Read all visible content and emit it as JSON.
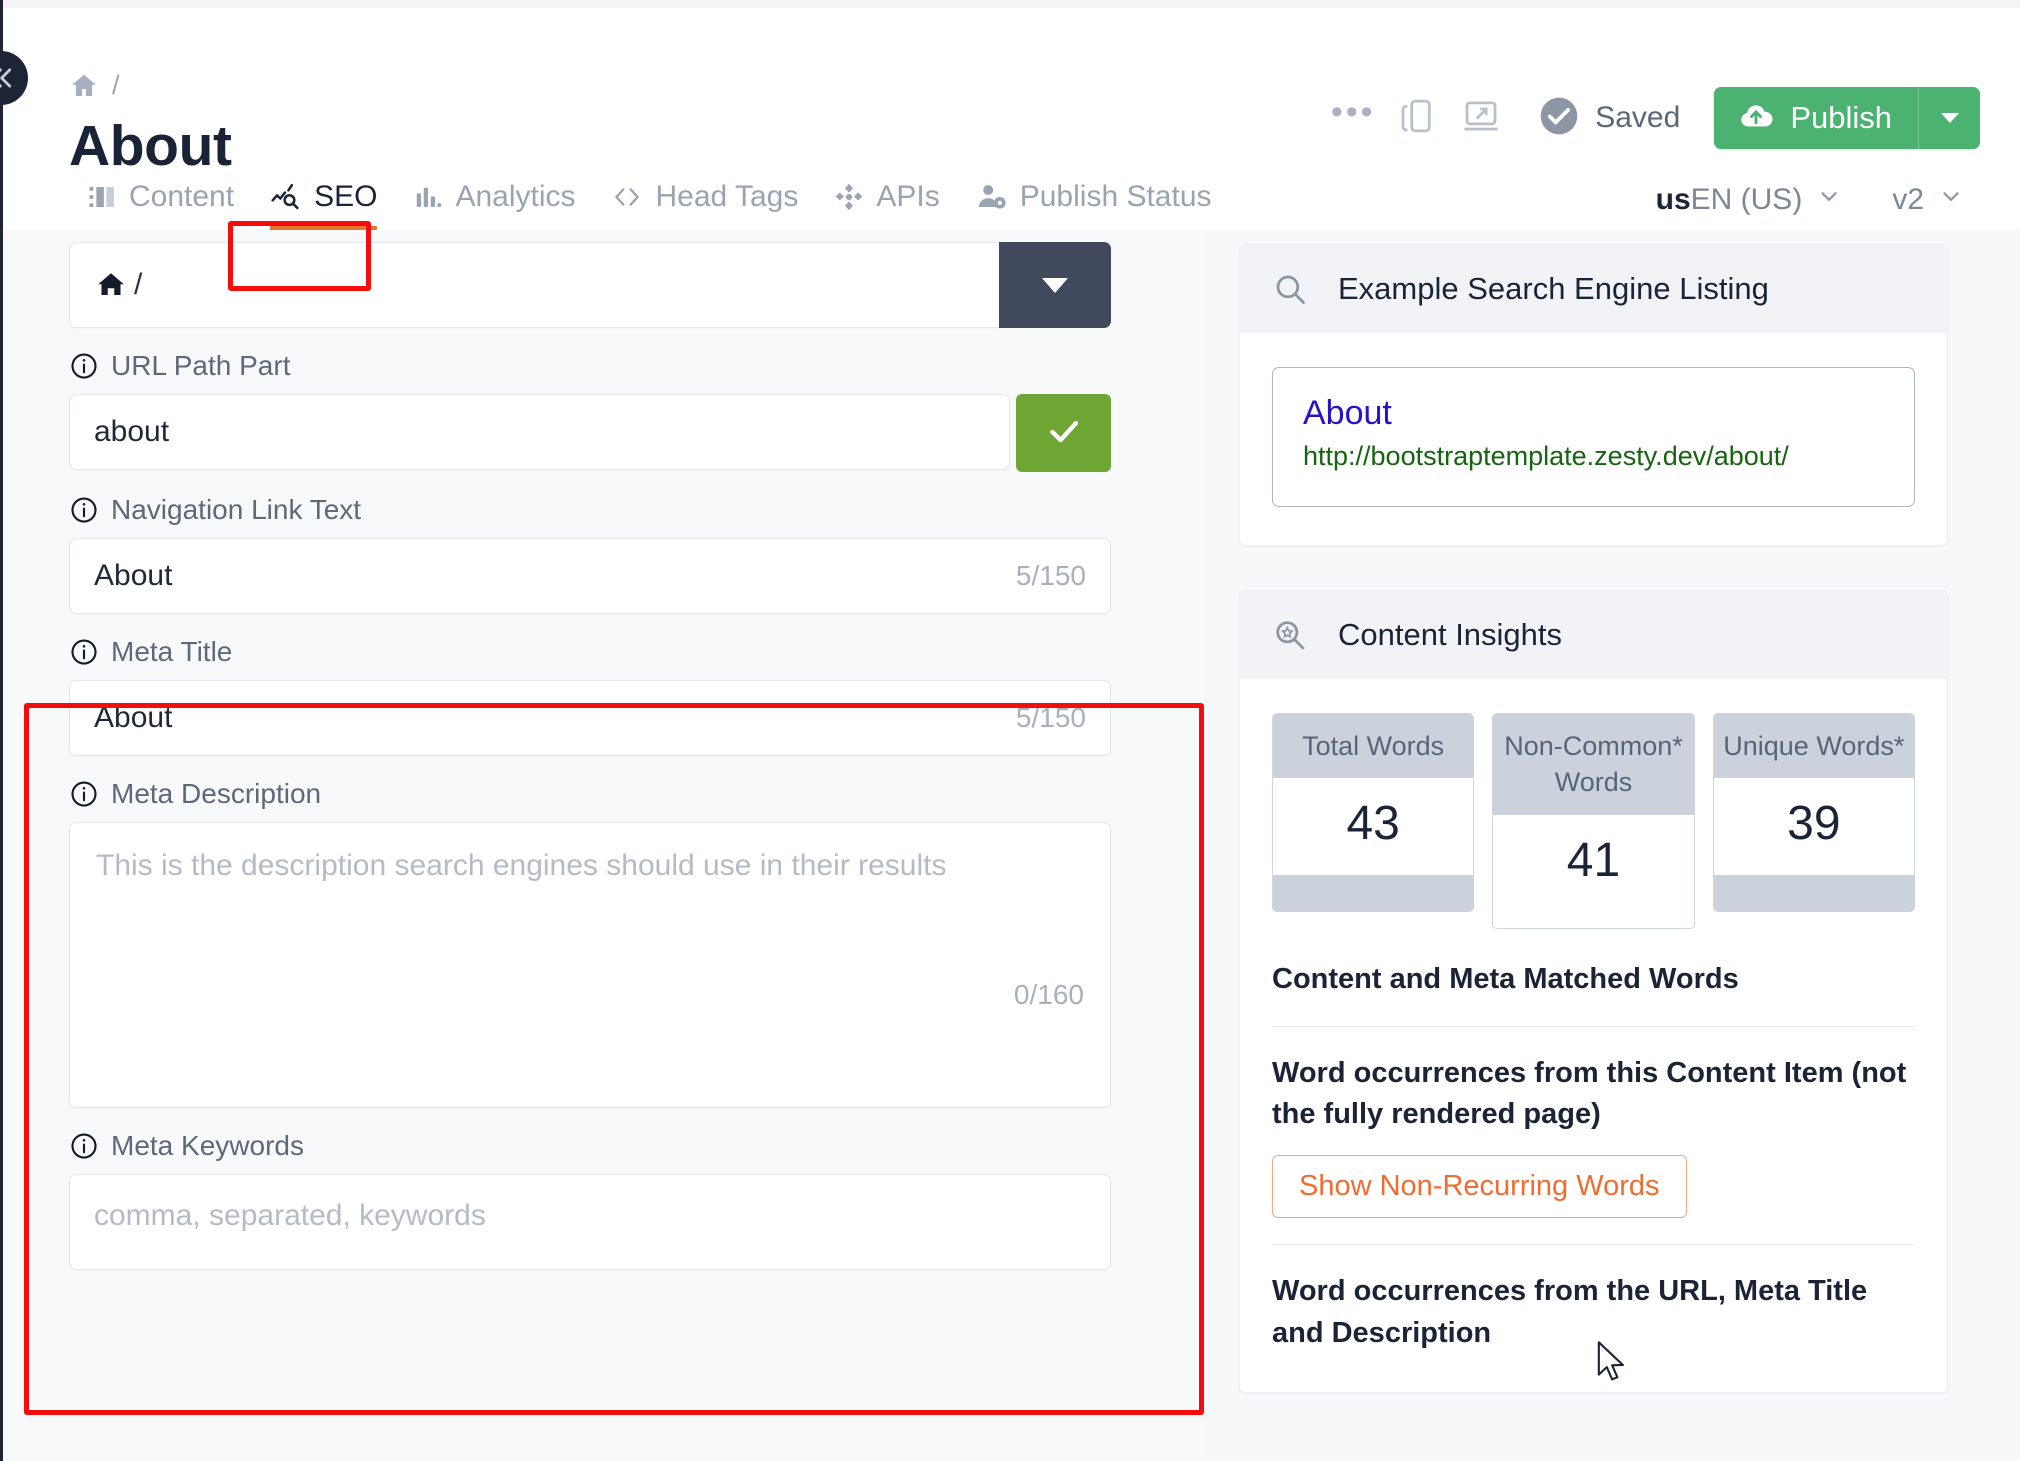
{
  "window": {
    "collapse_icon": "chevrons-left-icon"
  },
  "header": {
    "breadcrumb_home_icon": "home-icon",
    "breadcrumb_separator": "/",
    "page_title": "About",
    "more_icon": "ellipsis-icon",
    "more_label": "•••",
    "duplicate_icon": "copy-device-icon",
    "preview_icon": "open-in-browser-icon",
    "status_icon": "check-circle-icon",
    "status_label": "Saved",
    "publish_icon": "cloud-upload-icon",
    "publish_label": "Publish",
    "publish_caret_icon": "caret-down-icon"
  },
  "tabs": [
    {
      "label": "Content",
      "icon": "content-blocks-icon",
      "active": false
    },
    {
      "label": "SEO",
      "icon": "seo-search-icon",
      "active": true
    },
    {
      "label": "Analytics",
      "icon": "bar-chart-icon",
      "active": false
    },
    {
      "label": "Head Tags",
      "icon": "code-brackets-icon",
      "active": false
    },
    {
      "label": "APIs",
      "icon": "api-nodes-icon",
      "active": false
    },
    {
      "label": "Publish Status",
      "icon": "user-gear-icon",
      "active": false
    }
  ],
  "selectors": {
    "language_prefix": "us",
    "language_label": "EN (US)",
    "language_caret_icon": "chevron-down-icon",
    "version_label": "v2",
    "version_caret_icon": "chevron-down-icon"
  },
  "form": {
    "parent_path": {
      "home_icon": "home-icon",
      "value": "/",
      "caret_icon": "caret-down-icon"
    },
    "url_path_part": {
      "info_icon": "info-icon",
      "label": "URL Path Part",
      "value": "about",
      "confirm_icon": "check-icon"
    },
    "navigation_link_text": {
      "info_icon": "info-icon",
      "label": "Navigation Link Text",
      "value": "About",
      "counter": "5/150"
    },
    "meta_title": {
      "info_icon": "info-icon",
      "label": "Meta Title",
      "value": "About",
      "counter": "5/150"
    },
    "meta_description": {
      "info_icon": "info-icon",
      "label": "Meta Description",
      "placeholder": "This is the description search engines should use in their results",
      "value": "",
      "counter": "0/160"
    },
    "meta_keywords": {
      "info_icon": "info-icon",
      "label": "Meta Keywords",
      "placeholder": "comma, separated, keywords",
      "value": ""
    }
  },
  "search_listing": {
    "icon": "search-icon",
    "title": "Example Search Engine Listing",
    "result_title": "About",
    "result_url": "http://bootstraptemplate.zesty.dev/about/"
  },
  "content_insights": {
    "icon": "search-star-icon",
    "title": "Content Insights",
    "metrics": [
      {
        "label": "Total Words",
        "value": "43"
      },
      {
        "label": "Non-Common* Words",
        "value": "41"
      },
      {
        "label": "Unique Words*",
        "value": "39"
      }
    ],
    "matched_words_heading": "Content and Meta Matched Words",
    "content_item_heading": "Word occurrences from this Content Item (not the fully rendered page)",
    "show_button": "Show Non-Recurring Words",
    "url_meta_heading": "Word occurrences from the URL, Meta Title and Description"
  },
  "colors": {
    "publish_green": "#4cb272",
    "confirm_green": "#6ea634",
    "accent_orange": "#e8762a",
    "pill_orange": "#ef6c32",
    "dark_slate": "#414a5c",
    "annotation_red": "#f40d0d",
    "serp_title_blue": "#2a10c9",
    "serp_url_green": "#16640f"
  }
}
